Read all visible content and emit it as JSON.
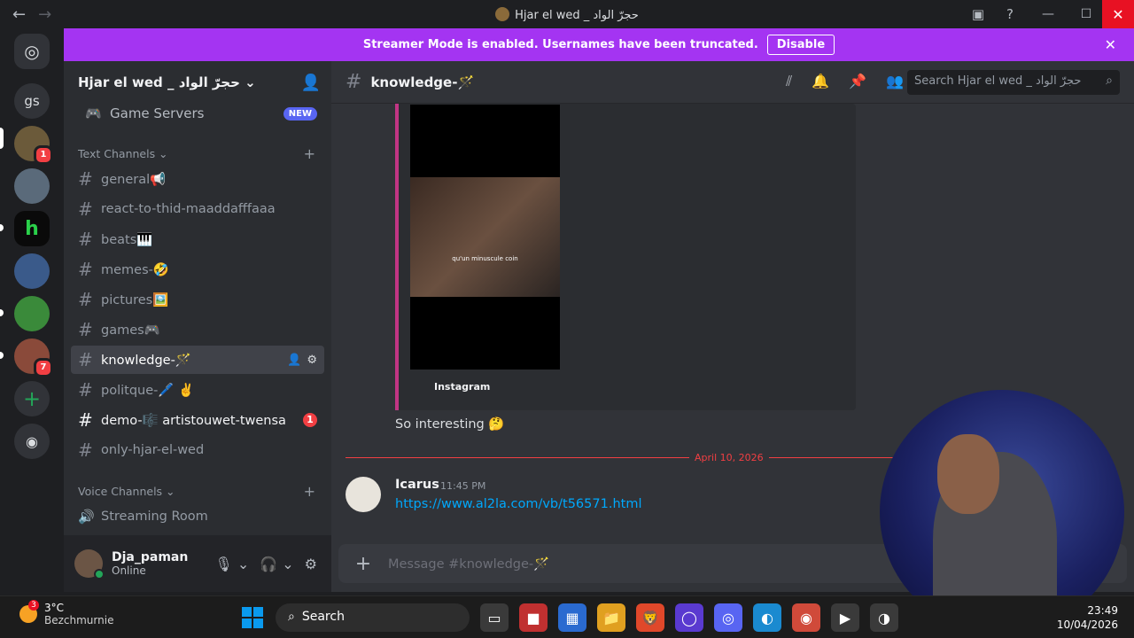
{
  "titlebar": {
    "back_glyph": "←",
    "forward_glyph": "→",
    "title": "Hjar el wed _ حجرّ الواد",
    "inbox_glyph": "▣",
    "help_glyph": "?",
    "minimize_glyph": "—",
    "maximize_glyph": "☐",
    "close_glyph": "✕"
  },
  "rail": {
    "home_glyph": "◎",
    "gs_label": "gs",
    "badge_1": "1",
    "badge_7": "7",
    "add_glyph": "+",
    "discover_glyph": "◉"
  },
  "banner": {
    "message": "Streamer Mode is enabled. Usernames have been truncated.",
    "button": "Disable",
    "close_glyph": "✕"
  },
  "sidebar": {
    "guild_name": "Hjar el wed _ حجرّ الواد ⌄",
    "invite_glyph": "👤",
    "game_servers": {
      "icon": "🎮",
      "label": "Game Servers",
      "badge": "NEW"
    },
    "text_category": "Text Channels ⌄",
    "voice_category": "Voice Channels ⌄",
    "plus_glyph": "+",
    "hash_glyph": "#",
    "channels": [
      {
        "label": "general📢"
      },
      {
        "label": "react-to-thid-maaddafffaaa"
      },
      {
        "label": "beats🎹"
      },
      {
        "label": "memes-🤣"
      },
      {
        "label": "pictures🖼️"
      },
      {
        "label": "games🎮"
      },
      {
        "label": "knowledge-🪄"
      },
      {
        "label": "politque-🖊️ ✌️"
      },
      {
        "label": "demo-🎼 artistouwet-twensa",
        "badge": "1"
      },
      {
        "label": "only-hjar-el-wed"
      }
    ],
    "active_tools": {
      "add_glyph": "👤",
      "gear_glyph": "⚙"
    },
    "voice_channels": [
      {
        "icon": "🔊",
        "label": "Streaming Room"
      }
    ]
  },
  "user": {
    "name": "Dja_paman",
    "status": "Online",
    "mic_glyph": "🎙 ⌄",
    "headset_glyph": "🎧 ⌄",
    "settings_glyph": "⚙"
  },
  "main": {
    "hash_glyph": "#",
    "channel_title": "knowledge-🪄",
    "tools": [
      "⫽",
      "🔔",
      "📌",
      "👥"
    ],
    "search_placeholder": "Search Hjar el wed _ حجرّ الواد",
    "search_glyph": "⌕",
    "embed": {
      "caption": "qu'un minuscule coin",
      "provider": "Instagram"
    },
    "message_text": "So interesting 🤔",
    "date_divider": "April 10, 2026",
    "message2": {
      "author": "Icarus",
      "time": "11:45 PM",
      "link": "https://www.al2la.com/vb/t56571.html"
    },
    "composer_plus": "+",
    "composer_placeholder": "Message #knowledge-🪄"
  },
  "taskbar": {
    "weather_badge": "3",
    "temperature": "3°C",
    "location": "Bezchmurnie",
    "search_glyph": "⌕",
    "search_label": "Search",
    "apps": [
      {
        "name": "task-view",
        "glyph": "▭",
        "color": "#3a3a3a"
      },
      {
        "name": "widgets",
        "glyph": "■",
        "color": "#c03030"
      },
      {
        "name": "store",
        "glyph": "▦",
        "color": "#2a6ad0"
      },
      {
        "name": "files",
        "glyph": "📁",
        "color": "#e0a020"
      },
      {
        "name": "brave",
        "glyph": "🦁",
        "color": "#e0482a"
      },
      {
        "name": "app-circle",
        "glyph": "◯",
        "color": "#5a3ad0"
      },
      {
        "name": "discord",
        "glyph": "◎",
        "color": "#5865f2"
      },
      {
        "name": "edge",
        "glyph": "◐",
        "color": "#1a8ad0"
      },
      {
        "name": "chrome",
        "glyph": "◉",
        "color": "#d04a3a"
      },
      {
        "name": "media",
        "glyph": "▶",
        "color": "#3a3a3a"
      },
      {
        "name": "obs",
        "glyph": "◑",
        "color": "#3a3a3a"
      }
    ],
    "time": "23:49",
    "date": "10/04/2026"
  },
  "colors": {
    "accent": "#a434f2",
    "blurple": "#5865f2",
    "danger": "#f23f43",
    "link": "#00a8fc",
    "online": "#23a559"
  }
}
